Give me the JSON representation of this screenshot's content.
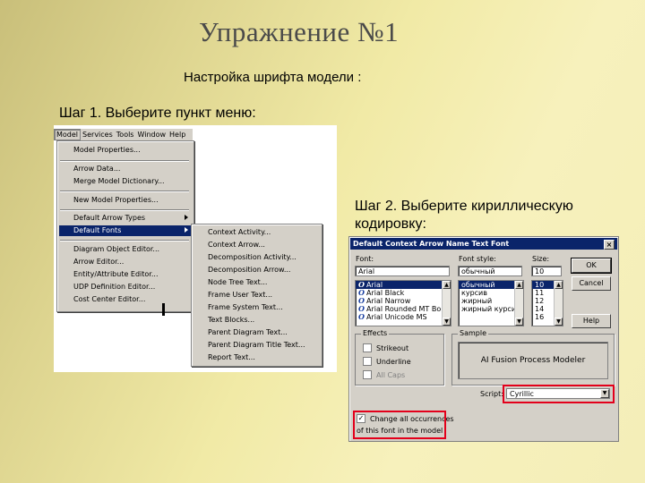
{
  "slide": {
    "title": "Упражнение №1",
    "subtitle": "Настройка шрифта модели :",
    "step1": "Шаг 1. Выберите пункт меню:",
    "step2": "Шаг 2. Выберите кириллическую кодировку:"
  },
  "menubar": [
    "Model",
    "Services",
    "Tools",
    "Window",
    "Help"
  ],
  "model_menu": {
    "items": [
      "Model Properties...",
      "Arrow Data...",
      "Merge Model Dictionary...",
      "New Model Properties...",
      "Default Arrow Types",
      "Default Fonts",
      "Diagram Object Editor...",
      "Arrow Editor...",
      "Entity/Attribute Editor...",
      "UDP Definition Editor...",
      "Cost Center Editor..."
    ],
    "highlighted": "Default Fonts"
  },
  "fonts_submenu": {
    "items": [
      "Context Activity...",
      "Context Arrow...",
      "Decomposition Activity...",
      "Decomposition Arrow...",
      "Node Tree Text...",
      "Frame User Text...",
      "Frame System Text...",
      "Text Blocks...",
      "Parent Diagram Text...",
      "Parent Diagram Title Text...",
      "Report Text..."
    ]
  },
  "dialog": {
    "title": "Default Context Arrow Name Text Font",
    "close": "×",
    "font_label": "Font:",
    "font_value": "Arial",
    "fonts": [
      "Arial",
      "Arial Black",
      "Arial Narrow",
      "Arial Rounded MT Bol",
      "Arial Unicode MS"
    ],
    "style_label": "Font style:",
    "style_value": "обычный",
    "styles": [
      "обычный",
      "курсив",
      "жирный",
      "жирный курсив"
    ],
    "size_label": "Size:",
    "size_value": "10",
    "sizes": [
      "10",
      "11",
      "12",
      "14",
      "16"
    ],
    "ok": "OK",
    "cancel": "Cancel",
    "help": "Help",
    "effects_label": "Effects",
    "strikeout": "Strikeout",
    "underline": "Underline",
    "all_caps": "All Caps",
    "sample_label": "Sample",
    "sample_text": "AI Fusion Process Modeler",
    "script_label": "Script:",
    "script_value": "Cyrillic",
    "change_all_line1": "Change all occurrences",
    "change_all_line2": "of this font in the model"
  },
  "colors": {
    "highlight": "#0a246a",
    "callout": "#e3001b",
    "title_text": "#4a4a4a"
  }
}
